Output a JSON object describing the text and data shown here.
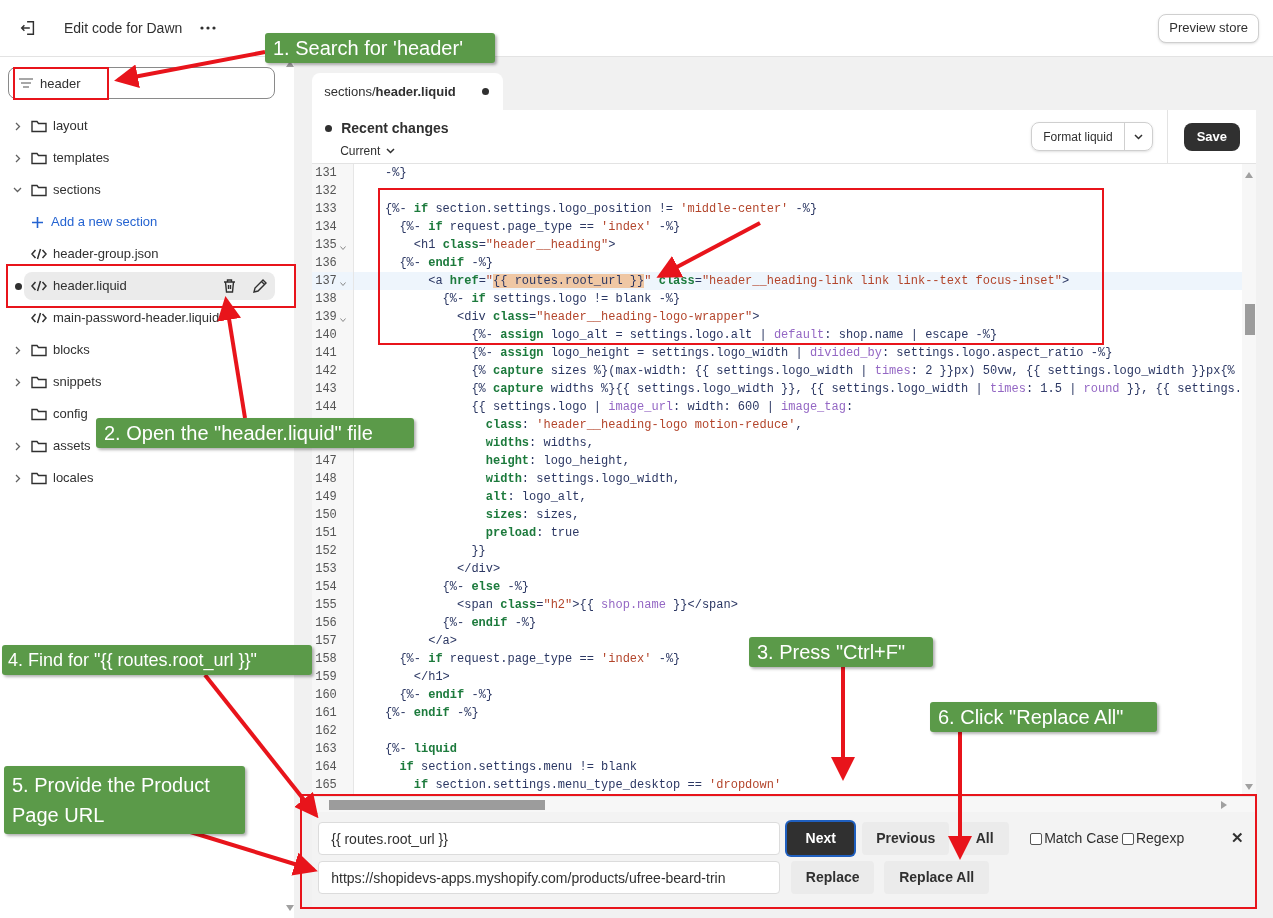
{
  "top_bar": {
    "title": "Edit code for Dawn",
    "preview_button": "Preview store"
  },
  "sidebar": {
    "search": {
      "value": "header"
    },
    "tree": [
      {
        "kind": "folder",
        "label": "layout",
        "expanded": false
      },
      {
        "kind": "folder",
        "label": "templates",
        "expanded": false
      },
      {
        "kind": "folder",
        "label": "sections",
        "expanded": true,
        "children": [
          {
            "kind": "add",
            "label": "Add a new section"
          },
          {
            "kind": "file",
            "label": "header-group.json",
            "selected": false,
            "modified": false
          },
          {
            "kind": "file",
            "label": "header.liquid",
            "selected": true,
            "modified": true
          },
          {
            "kind": "file",
            "label": "main-password-header.liquid",
            "selected": false,
            "modified": false
          }
        ]
      },
      {
        "kind": "folder",
        "label": "blocks",
        "expanded": false
      },
      {
        "kind": "folder",
        "label": "snippets",
        "expanded": false
      },
      {
        "kind": "folder",
        "label": "config"
      },
      {
        "kind": "folder",
        "label": "assets",
        "expanded": false
      },
      {
        "kind": "folder",
        "label": "locales",
        "expanded": false
      }
    ]
  },
  "editor": {
    "tab": {
      "label": "sections/**header.liquid**",
      "modified": true
    },
    "recent_changes": "Recent changes",
    "version": "Current",
    "format_button": "Format liquid",
    "save_button": "Save",
    "lines": [
      {
        "number": "131",
        "tokens": [
          {
            "kind": "plain",
            "text": "    -%}"
          }
        ]
      },
      {
        "number": "132"
      },
      {
        "number": "133",
        "tokens": [
          {
            "kind": "plain",
            "text": "    {%- "
          },
          {
            "kind": "keyword",
            "text": "if"
          },
          {
            "kind": "plain",
            "text": " section.settings.logo_position != "
          },
          {
            "kind": "string",
            "text": "'middle-center'"
          },
          {
            "kind": "plain",
            "text": " -%}"
          }
        ]
      },
      {
        "number": "134",
        "tokens": [
          {
            "kind": "plain",
            "text": "      {%- "
          },
          {
            "kind": "keyword",
            "text": "if"
          },
          {
            "kind": "plain",
            "text": " request.page_type == "
          },
          {
            "kind": "string",
            "text": "'index'"
          },
          {
            "kind": "plain",
            "text": " -%}"
          }
        ]
      },
      {
        "number": "135",
        "fold": true,
        "tokens": [
          {
            "kind": "plain",
            "text": "        <h1 "
          },
          {
            "kind": "keyword",
            "text": "class"
          },
          {
            "kind": "plain",
            "text": "="
          },
          {
            "kind": "string",
            "text": "\"header__heading\""
          },
          {
            "kind": "plain",
            "text": ">"
          }
        ]
      },
      {
        "number": "136",
        "tokens": [
          {
            "kind": "plain",
            "text": "      {%- "
          },
          {
            "kind": "keyword",
            "text": "endif"
          },
          {
            "kind": "plain",
            "text": " -%}"
          }
        ]
      },
      {
        "number": "137",
        "fold": true,
        "current": true,
        "tokens": [
          {
            "kind": "plain",
            "text": "          <a "
          },
          {
            "kind": "keyword",
            "text": "href"
          },
          {
            "kind": "plain",
            "text": "="
          },
          {
            "kind": "string",
            "text": "\""
          },
          {
            "kind": "match",
            "text": "{{ routes.root_url }}"
          },
          {
            "kind": "string",
            "text": "\""
          },
          {
            "kind": "keyword",
            "text": " class"
          },
          {
            "kind": "plain",
            "text": "="
          },
          {
            "kind": "string",
            "text": "\"header__heading-link link link--text focus-inset\""
          },
          {
            "kind": "plain",
            "text": ">"
          }
        ]
      },
      {
        "number": "138",
        "tokens": [
          {
            "kind": "plain",
            "text": "            {%- "
          },
          {
            "kind": "keyword",
            "text": "if"
          },
          {
            "kind": "plain",
            "text": " settings.logo != blank -%}"
          }
        ]
      },
      {
        "number": "139",
        "fold": true,
        "tokens": [
          {
            "kind": "plain",
            "text": "              <div "
          },
          {
            "kind": "keyword",
            "text": "class"
          },
          {
            "kind": "plain",
            "text": "="
          },
          {
            "kind": "string",
            "text": "\"header__heading-logo-wrapper\""
          },
          {
            "kind": "plain",
            "text": ">"
          }
        ]
      },
      {
        "number": "140",
        "tokens": [
          {
            "kind": "plain",
            "text": "                {%- "
          },
          {
            "kind": "keyword",
            "text": "assign"
          },
          {
            "kind": "plain",
            "text": " logo_alt = settings.logo.alt | "
          },
          {
            "kind": "filter",
            "text": "default"
          },
          {
            "kind": "plain",
            "text": ": shop.name | escape -%}"
          }
        ]
      },
      {
        "number": "141",
        "tokens": [
          {
            "kind": "plain",
            "text": "                {%- "
          },
          {
            "kind": "keyword",
            "text": "assign"
          },
          {
            "kind": "plain",
            "text": " logo_height = settings.logo_width | "
          },
          {
            "kind": "filter",
            "text": "divided_by"
          },
          {
            "kind": "plain",
            "text": ": settings.logo.aspect_ratio -%}"
          }
        ]
      },
      {
        "number": "142",
        "tokens": [
          {
            "kind": "plain",
            "text": "                {% "
          },
          {
            "kind": "keyword",
            "text": "capture"
          },
          {
            "kind": "plain",
            "text": " sizes %}(max-width: {{ settings.logo_width | "
          },
          {
            "kind": "filter",
            "text": "times"
          },
          {
            "kind": "plain",
            "text": ": 2 }}px) 50vw, {{ settings.logo_width }}px{%"
          }
        ]
      },
      {
        "number": "143",
        "tokens": [
          {
            "kind": "plain",
            "text": "                {% "
          },
          {
            "kind": "keyword",
            "text": "capture"
          },
          {
            "kind": "plain",
            "text": " widths %}{{ settings.logo_width }}, {{ settings.logo_width | "
          },
          {
            "kind": "filter",
            "text": "times"
          },
          {
            "kind": "plain",
            "text": ": 1.5 | "
          },
          {
            "kind": "filter",
            "text": "round"
          },
          {
            "kind": "plain",
            "text": " }}, {{ settings."
          }
        ]
      },
      {
        "number": "144",
        "tokens": [
          {
            "kind": "plain",
            "text": "                {{ settings.logo | "
          },
          {
            "kind": "filter",
            "text": "image_url"
          },
          {
            "kind": "plain",
            "text": ": width: 600 | "
          },
          {
            "kind": "filter",
            "text": "image_tag"
          },
          {
            "kind": "plain",
            "text": ":"
          }
        ]
      },
      {
        "tokens": [
          {
            "kind": "keyword",
            "text": "                  class"
          },
          {
            "kind": "plain",
            "text": ": "
          },
          {
            "kind": "string",
            "text": "'header__heading-logo motion-reduce'"
          },
          {
            "kind": "plain",
            "text": ","
          }
        ]
      },
      {
        "tokens": [
          {
            "kind": "keyword",
            "text": "                  widths"
          },
          {
            "kind": "plain",
            "text": ": widths,"
          }
        ]
      },
      {
        "number": "147",
        "tokens": [
          {
            "kind": "keyword",
            "text": "                  height"
          },
          {
            "kind": "plain",
            "text": ": logo_height,"
          }
        ]
      },
      {
        "number": "148",
        "tokens": [
          {
            "kind": "keyword",
            "text": "                  width"
          },
          {
            "kind": "plain",
            "text": ": settings.logo_width,"
          }
        ]
      },
      {
        "number": "149",
        "tokens": [
          {
            "kind": "keyword",
            "text": "                  alt"
          },
          {
            "kind": "plain",
            "text": ": logo_alt,"
          }
        ]
      },
      {
        "number": "150",
        "tokens": [
          {
            "kind": "keyword",
            "text": "                  sizes"
          },
          {
            "kind": "plain",
            "text": ": sizes,"
          }
        ]
      },
      {
        "number": "151",
        "tokens": [
          {
            "kind": "keyword",
            "text": "                  preload"
          },
          {
            "kind": "plain",
            "text": ": true"
          }
        ]
      },
      {
        "number": "152",
        "tokens": [
          {
            "kind": "plain",
            "text": "                }}"
          }
        ]
      },
      {
        "number": "153",
        "tokens": [
          {
            "kind": "plain",
            "text": "              </div>"
          }
        ]
      },
      {
        "number": "154",
        "tokens": [
          {
            "kind": "plain",
            "text": "            {%- "
          },
          {
            "kind": "keyword",
            "text": "else"
          },
          {
            "kind": "plain",
            "text": " -%}"
          }
        ]
      },
      {
        "number": "155",
        "tokens": [
          {
            "kind": "plain",
            "text": "              <span "
          },
          {
            "kind": "keyword",
            "text": "class"
          },
          {
            "kind": "plain",
            "text": "="
          },
          {
            "kind": "string",
            "text": "\"h2\""
          },
          {
            "kind": "plain",
            "text": ">{{ "
          },
          {
            "kind": "filter",
            "text": "shop.name"
          },
          {
            "kind": "plain",
            "text": " }}</span>"
          }
        ]
      },
      {
        "number": "156",
        "tokens": [
          {
            "kind": "plain",
            "text": "            {%- "
          },
          {
            "kind": "keyword",
            "text": "endif"
          },
          {
            "kind": "plain",
            "text": " -%}"
          }
        ]
      },
      {
        "number": "157",
        "tokens": [
          {
            "kind": "plain",
            "text": "          </a>"
          }
        ]
      },
      {
        "number": "158",
        "tokens": [
          {
            "kind": "plain",
            "text": "      {%- "
          },
          {
            "kind": "keyword",
            "text": "if"
          },
          {
            "kind": "plain",
            "text": " request.page_type == "
          },
          {
            "kind": "string",
            "text": "'index'"
          },
          {
            "kind": "plain",
            "text": " -%}"
          }
        ]
      },
      {
        "number": "159",
        "tokens": [
          {
            "kind": "plain",
            "text": "        </h1>"
          }
        ]
      },
      {
        "number": "160",
        "tokens": [
          {
            "kind": "plain",
            "text": "      {%- "
          },
          {
            "kind": "keyword",
            "text": "endif"
          },
          {
            "kind": "plain",
            "text": " -%}"
          }
        ]
      },
      {
        "number": "161",
        "tokens": [
          {
            "kind": "plain",
            "text": "    {%- "
          },
          {
            "kind": "keyword",
            "text": "endif"
          },
          {
            "kind": "plain",
            "text": " -%}"
          }
        ]
      },
      {
        "number": "162"
      },
      {
        "number": "163",
        "tokens": [
          {
            "kind": "plain",
            "text": "    {%- "
          },
          {
            "kind": "keyword",
            "text": "liquid"
          }
        ]
      },
      {
        "number": "164",
        "tokens": [
          {
            "kind": "keyword",
            "text": "      if"
          },
          {
            "kind": "plain",
            "text": " section.settings.menu != blank"
          }
        ]
      },
      {
        "number": "165",
        "tokens": [
          {
            "kind": "keyword",
            "text": "        if"
          },
          {
            "kind": "plain",
            "text": " section.settings.menu_type_desktop == "
          },
          {
            "kind": "string",
            "text": "'dropdown'"
          }
        ]
      }
    ]
  },
  "find_panel": {
    "find_value": "{{ routes.root_url }}",
    "replace_value": "https://shopidevs-apps.myshopify.com/products/ufree-beard-trin",
    "next_button": "Next",
    "previous_button": "Previous",
    "all_button": "All",
    "options": [
      {
        "label": "Match Case",
        "checked": false
      },
      {
        "label": "Regexp",
        "checked": false
      }
    ],
    "close": "✕",
    "replace_button": "Replace",
    "replace_all_button": "Replace All"
  },
  "annotations": [
    {
      "text": "1. Search for 'header'"
    },
    {
      "text": "2. Open the \"header.liquid\" file"
    },
    {
      "text": "3. Press \"Ctrl+F\""
    },
    {
      "text": "4. Find for \"{{ routes.root_url }}\""
    },
    {
      "text": "5. Provide the Product Page URL"
    },
    {
      "text": "6. Click \"Replace All\""
    }
  ]
}
